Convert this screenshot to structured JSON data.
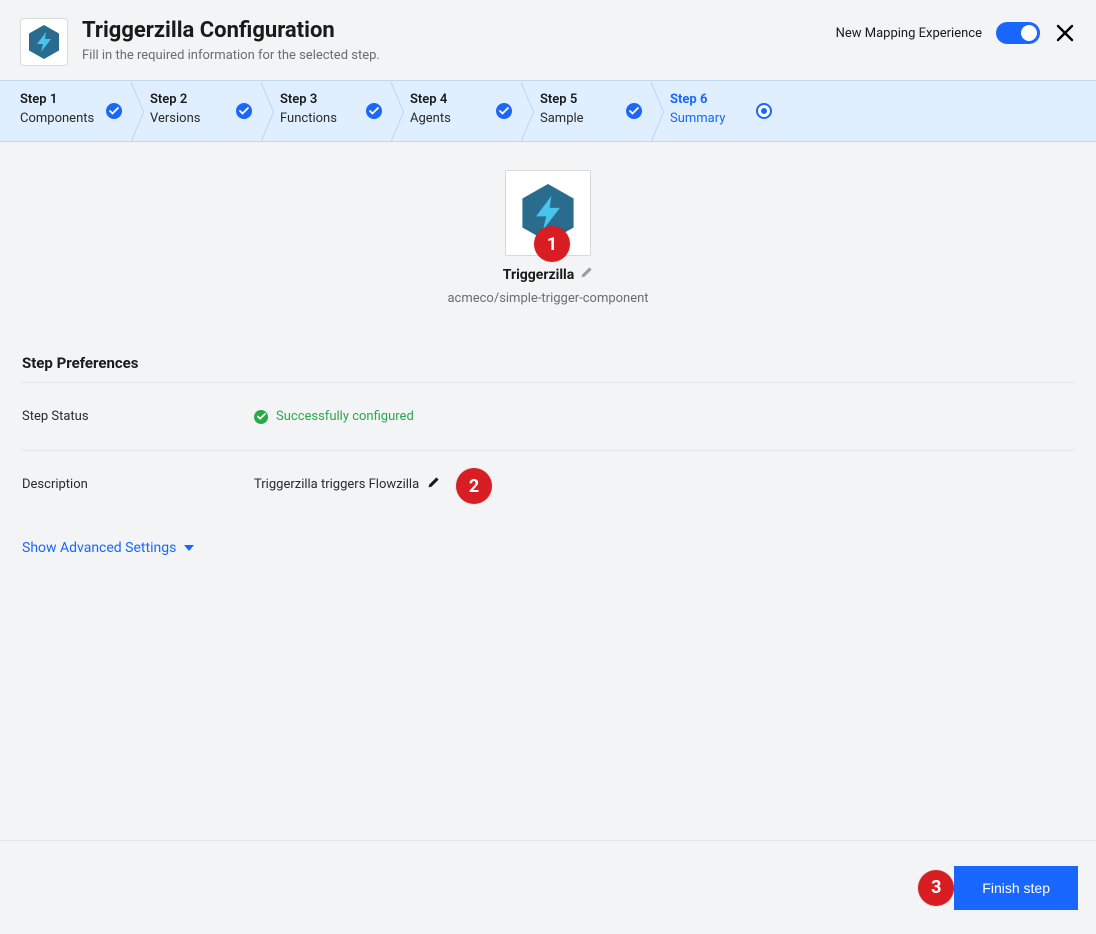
{
  "header": {
    "title": "Triggerzilla Configuration",
    "subtitle": "Fill in the required information for the selected step.",
    "toggle_label": "New Mapping Experience"
  },
  "stepper": [
    {
      "num": "Step 1",
      "label": "Components",
      "active": false
    },
    {
      "num": "Step 2",
      "label": "Versions",
      "active": false
    },
    {
      "num": "Step 3",
      "label": "Functions",
      "active": false
    },
    {
      "num": "Step 4",
      "label": "Agents",
      "active": false
    },
    {
      "num": "Step 5",
      "label": "Sample",
      "active": false
    },
    {
      "num": "Step 6",
      "label": "Summary",
      "active": true
    }
  ],
  "component": {
    "name": "Triggerzilla",
    "slug": "acmeco/simple-trigger-component"
  },
  "prefs": {
    "section_title": "Step Preferences",
    "status_label": "Step Status",
    "status_value": "Successfully configured",
    "desc_label": "Description",
    "desc_value": "Triggerzilla triggers Flowzilla",
    "advanced_label": "Show Advanced Settings"
  },
  "footer": {
    "finish_label": "Finish step"
  },
  "annotations": {
    "a1": "1",
    "a2": "2",
    "a3": "3"
  }
}
